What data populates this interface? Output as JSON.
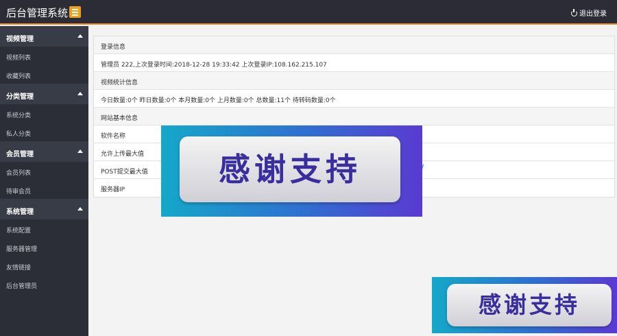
{
  "header": {
    "title": "后台管理系统",
    "logout_label": "退出登录"
  },
  "sidebar": {
    "groups": [
      {
        "label": "视频管理",
        "items": [
          "视频列表",
          "收藏列表"
        ]
      },
      {
        "label": "分类管理",
        "items": [
          "系统分类",
          "私人分类"
        ]
      },
      {
        "label": "会员管理",
        "items": [
          "会员列表",
          "待审会员"
        ]
      },
      {
        "label": "系统管理",
        "items": [
          "系统配置",
          "服务器管理",
          "友情链接",
          "后台管理员"
        ]
      }
    ]
  },
  "main": {
    "rows": [
      {
        "text": "登录信息",
        "head": true
      },
      {
        "text": "管理员 222,上次登录时间:2018-12-28 19:33:42 上次登录IP:108.162.215.107",
        "head": false
      },
      {
        "text": "视频统计信息",
        "head": true
      },
      {
        "text": "今日数量:0个 昨日数量:0个 本月数量:0个 上月数量:0个 总数量:11个 待转码数量:0个",
        "head": false
      },
      {
        "text": "网站基本信息",
        "head": true
      },
      {
        "text": "软件名称",
        "head": false
      },
      {
        "text": "允许上传最大值",
        "head": false
      },
      {
        "text": "POST提交最大值",
        "head": false
      },
      {
        "text": "服务器IP",
        "head": false
      }
    ],
    "partial_link": "m/"
  },
  "banners": {
    "large": "感谢支持",
    "small": "感谢支持"
  }
}
